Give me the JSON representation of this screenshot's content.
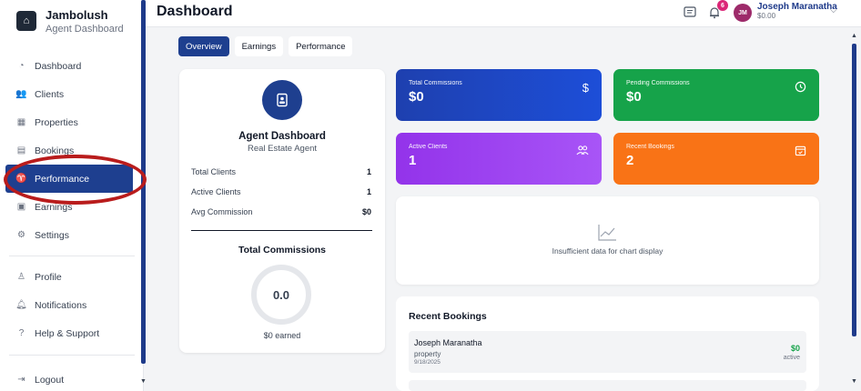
{
  "brand": {
    "title": "Jambolush",
    "subtitle": "Agent Dashboard"
  },
  "sidebar": {
    "items": [
      {
        "label": "Dashboard",
        "icon": "gauge-icon"
      },
      {
        "label": "Clients",
        "icon": "users-icon"
      },
      {
        "label": "Properties",
        "icon": "building-icon"
      },
      {
        "label": "Bookings",
        "icon": "calendar-icon"
      },
      {
        "label": "Performance",
        "icon": "trophy-icon"
      },
      {
        "label": "Earnings",
        "icon": "money-icon"
      },
      {
        "label": "Settings",
        "icon": "gear-icon"
      }
    ],
    "secondary": [
      {
        "label": "Profile",
        "icon": "user-icon"
      },
      {
        "label": "Notifications",
        "icon": "bell-icon"
      },
      {
        "label": "Help & Support",
        "icon": "help-icon"
      }
    ],
    "logout": "Logout",
    "active": "Performance"
  },
  "header": {
    "title": "Dashboard",
    "notification_count": "6",
    "user": {
      "initials": "JM",
      "name": "Joseph Maranatha",
      "balance": "$0.00"
    }
  },
  "tabs": [
    {
      "label": "Overview",
      "active": true
    },
    {
      "label": "Earnings",
      "active": false
    },
    {
      "label": "Performance",
      "active": false
    }
  ],
  "profile": {
    "name": "Agent Dashboard",
    "role": "Real Estate Agent",
    "stats": [
      {
        "label": "Total Clients",
        "value": "1"
      },
      {
        "label": "Active Clients",
        "value": "1"
      },
      {
        "label": "Avg Commission",
        "value": "$0"
      }
    ],
    "total_commissions_title": "Total Commissions",
    "total_commissions_value": "0.0",
    "earned": "$0 earned"
  },
  "cards": {
    "total_commissions": {
      "label": "Total Commissions",
      "value": "$0",
      "color": "#1d4ed8"
    },
    "pending_commissions": {
      "label": "Pending Commissions",
      "value": "$0",
      "color": "#16a34a"
    },
    "active_clients": {
      "label": "Active Clients",
      "value": "1",
      "color": "#a855f7"
    },
    "recent_bookings": {
      "label": "Recent Bookings",
      "value": "2",
      "color": "#f97316"
    }
  },
  "chart": {
    "message": "Insufficient data for chart display"
  },
  "bookings": {
    "title": "Recent Bookings",
    "rows": [
      {
        "name": "Joseph Maranatha",
        "type": "property",
        "date": "9/18/2025",
        "amount": "$0",
        "status": "active"
      }
    ]
  }
}
